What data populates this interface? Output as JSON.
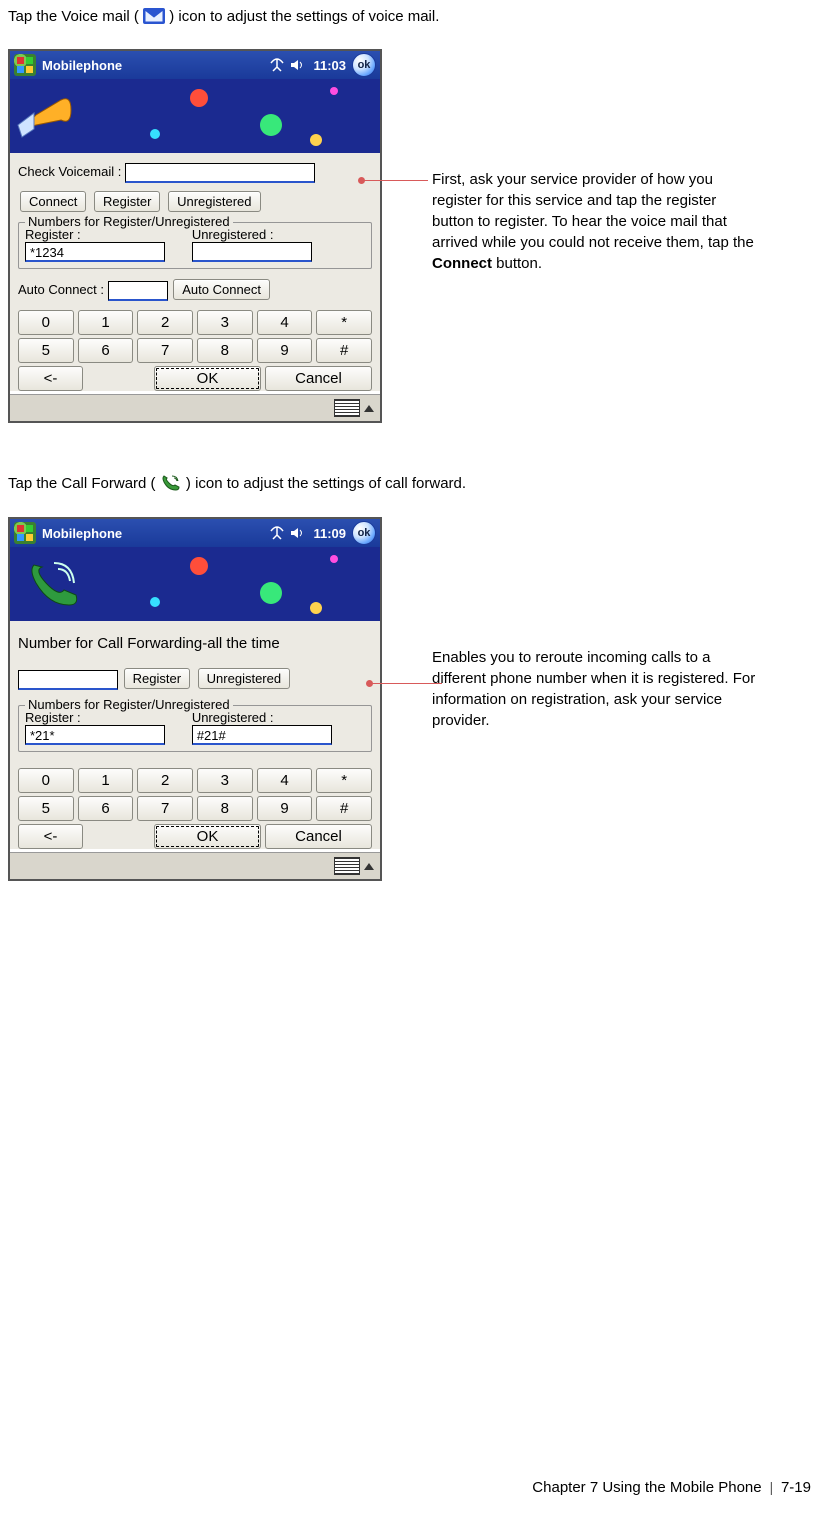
{
  "intro1_pre": "Tap the Voice mail (",
  "intro1_post": ") icon to adjust the settings of voice mail.",
  "intro2_pre": "Tap the Call Forward (",
  "intro2_post": ") icon to adjust the settings of call forward.",
  "shots": {
    "voicemail": {
      "title": "Mobilephone",
      "time": "11:03",
      "ok": "ok",
      "checkVoicemailLabel": "Check Voicemail :",
      "checkVoicemailValue": "",
      "btnConnect": "Connect",
      "btnRegister": "Register",
      "btnUnregistered": "Unregistered",
      "fieldsetLegend": "Numbers for Register/Unregistered",
      "registerLabel": "Register :",
      "unregisteredLabel": "Unregistered :",
      "registerValue": "*1234",
      "unregisteredValue": "",
      "autoConnectLabel": "Auto Connect :",
      "autoConnectValue": "",
      "btnAutoConnect": "Auto Connect",
      "keypad": {
        "r1": [
          "0",
          "1",
          "2",
          "3",
          "4",
          "*"
        ],
        "r2": [
          "5",
          "6",
          "7",
          "8",
          "9",
          "#"
        ],
        "back": "<-",
        "ok": "OK",
        "cancel": "Cancel"
      }
    },
    "callforward": {
      "title": "Mobilephone",
      "time": "11:09",
      "ok": "ok",
      "headline": "Number for Call Forwarding-all the time",
      "numberValue": "",
      "btnRegister": "Register",
      "btnUnregistered": "Unregistered",
      "fieldsetLegend": "Numbers for Register/Unregistered",
      "registerLabel": "Register :",
      "unregisteredLabel": "Unregistered :",
      "registerValue": "*21*",
      "unregisteredValue": "#21#",
      "keypad": {
        "r1": [
          "0",
          "1",
          "2",
          "3",
          "4",
          "*"
        ],
        "r2": [
          "5",
          "6",
          "7",
          "8",
          "9",
          "#"
        ],
        "back": "<-",
        "ok": "OK",
        "cancel": "Cancel"
      }
    }
  },
  "annot1_a": "First, ask your service provider of how you register for this service and tap the register button to register. To hear the voice mail that arrived while you could not receive them, tap the ",
  "annot1_bold": "Connect",
  "annot1_b": " button.",
  "annot2": "Enables you to reroute incoming calls to a different phone number when it is registered. For information on registration, ask your service provider.",
  "footer": {
    "chapter": "Chapter 7 Using the Mobile Phone",
    "page": "7-19"
  }
}
